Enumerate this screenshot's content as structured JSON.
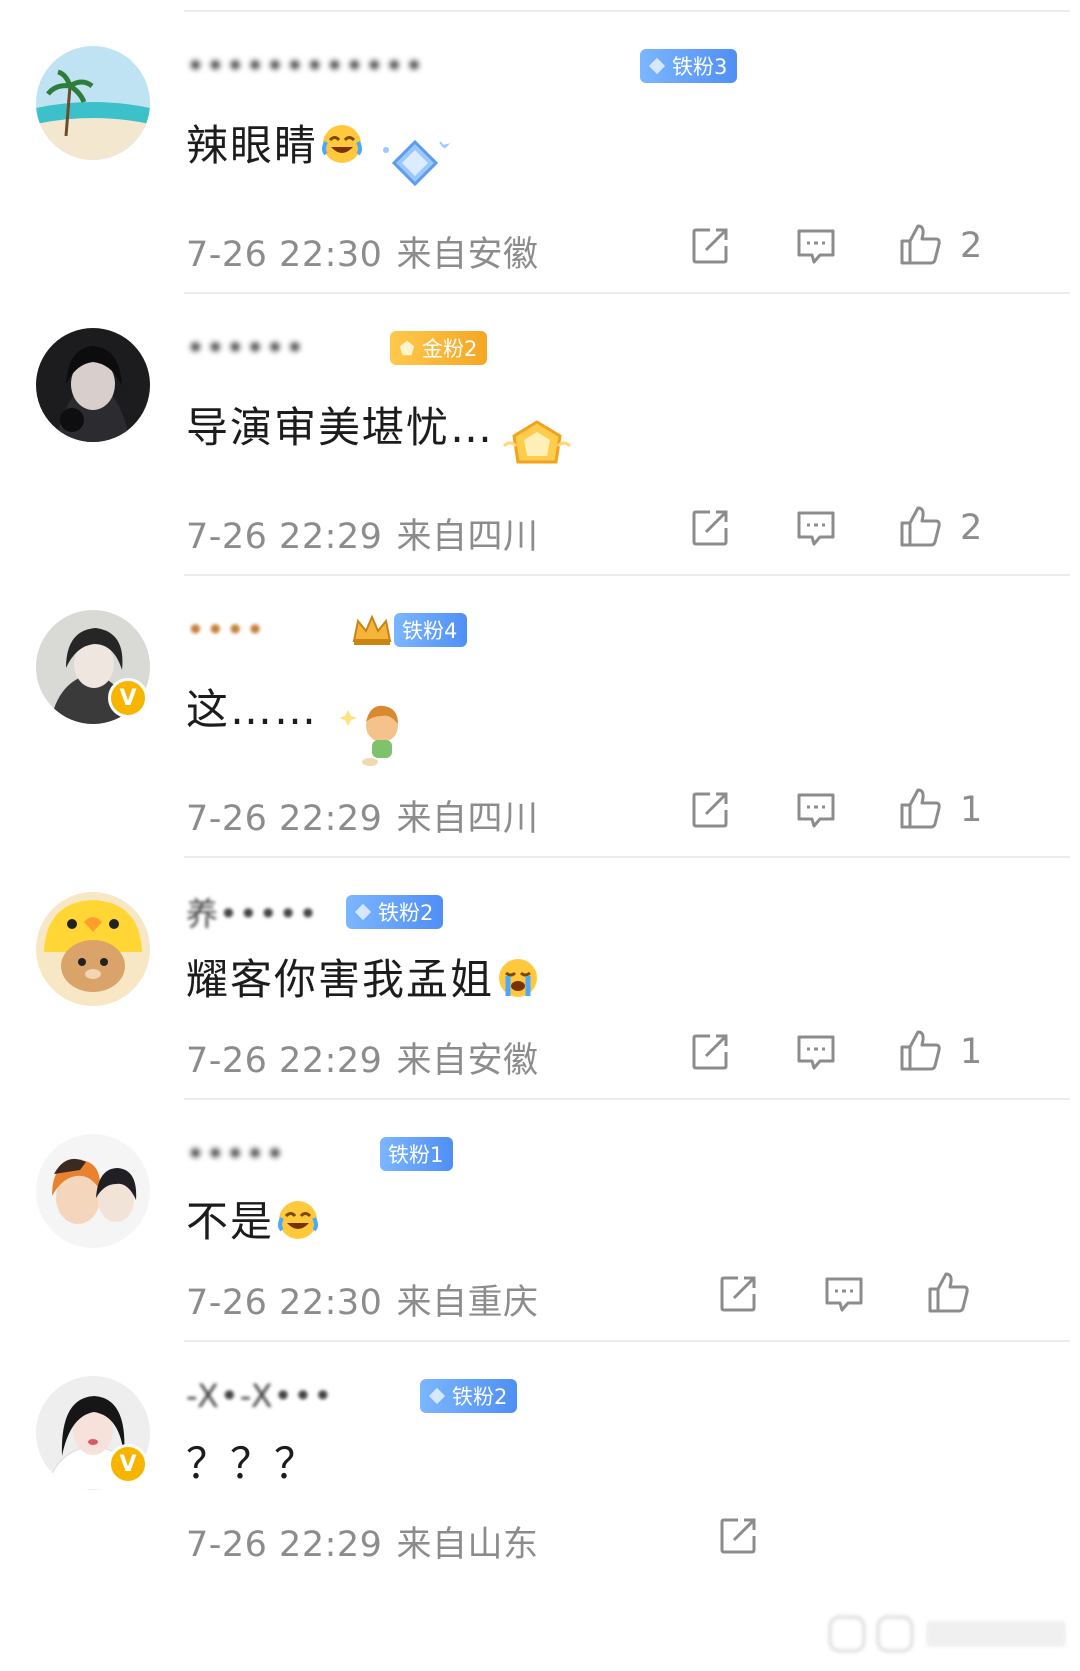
{
  "comments": [
    {
      "username": "••••••••••••",
      "badge": {
        "label": "铁粉3",
        "style": "blue"
      },
      "text": "辣眼睛",
      "emoji": "laugh-cry",
      "time": "7-26 22:30",
      "location": "来自安徽",
      "likes": "2",
      "verified": false
    },
    {
      "username": "••••••",
      "badge": {
        "label": "金粉2",
        "style": "gold"
      },
      "text": "导演审美堪忧…",
      "emoji": "",
      "time": "7-26 22:29",
      "location": "来自四川",
      "likes": "2",
      "verified": false
    },
    {
      "username": "••••",
      "badge": {
        "label": "铁粉4",
        "style": "blue"
      },
      "text": "这……",
      "emoji": "",
      "time": "7-26 22:29",
      "location": "来自四川",
      "likes": "1",
      "verified": true
    },
    {
      "username": "养•••••",
      "badge": {
        "label": "铁粉2",
        "style": "blue"
      },
      "text": "耀客你害我孟姐",
      "emoji": "crying",
      "time": "7-26 22:29",
      "location": "来自安徽",
      "likes": "1",
      "verified": false
    },
    {
      "username": "•••••",
      "badge": {
        "label": "铁粉1",
        "style": "blue"
      },
      "text": "不是",
      "emoji": "laugh-cry",
      "time": "7-26 22:30",
      "location": "来自重庆",
      "likes": "",
      "verified": false
    },
    {
      "username": "-X•-X•••",
      "badge": {
        "label": "铁粉2",
        "style": "blue"
      },
      "text": "？？？",
      "emoji": "",
      "time": "7-26 22:29",
      "location": "来自山东",
      "likes": "",
      "verified": true
    }
  ],
  "icons": {
    "share": "share-icon",
    "reply": "comment-icon",
    "like": "thumbs-up-icon"
  },
  "colors": {
    "meta_text": "#8c8c8c",
    "badge_blue": "#4f8ff5",
    "badge_gold": "#f5a623",
    "verified": "#f7b500"
  }
}
